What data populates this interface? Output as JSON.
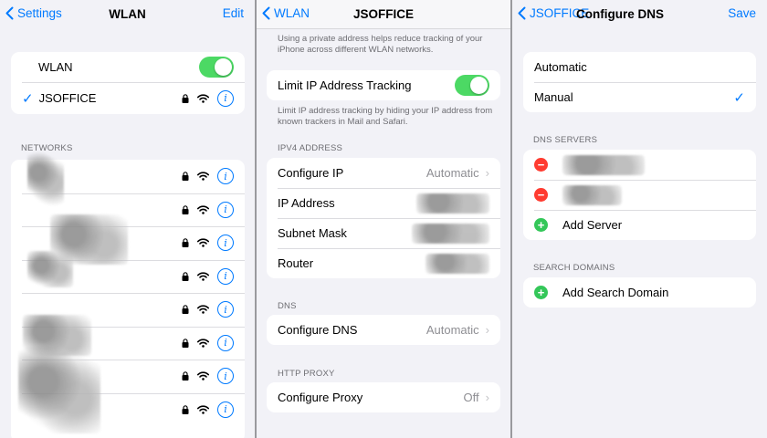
{
  "panel1": {
    "back_label": "Settings",
    "title": "WLAN",
    "right_action": "Edit",
    "wlan_toggle_label": "WLAN",
    "wlan_toggle_on": true,
    "connected_network": "JSOFFICE",
    "networks_header": "NETWORKS",
    "network_rows": 8
  },
  "panel2": {
    "back_label": "WLAN",
    "title": "JSOFFICE",
    "private_note": "Using a private address helps reduce tracking of your iPhone across different WLAN networks.",
    "limit_tracking_label": "Limit IP Address Tracking",
    "limit_tracking_on": true,
    "limit_tracking_note": "Limit IP address tracking by hiding your IP address from known trackers in Mail and Safari.",
    "ipv4_header": "IPV4 ADDRESS",
    "configure_ip_label": "Configure IP",
    "configure_ip_value": "Automatic",
    "ip_address_label": "IP Address",
    "subnet_mask_label": "Subnet Mask",
    "router_label": "Router",
    "dns_header": "DNS",
    "configure_dns_label": "Configure DNS",
    "configure_dns_value": "Automatic",
    "http_proxy_header": "HTTP PROXY",
    "configure_proxy_label": "Configure Proxy",
    "configure_proxy_value": "Off"
  },
  "panel3": {
    "back_label": "JSOFFICE",
    "title": "Configure DNS",
    "right_action": "Save",
    "mode_automatic": "Automatic",
    "mode_manual": "Manual",
    "selected_mode": "Manual",
    "dns_servers_header": "DNS SERVERS",
    "add_server_label": "Add Server",
    "search_domains_header": "SEARCH DOMAINS",
    "add_search_domain_label": "Add Search Domain"
  },
  "colors": {
    "accent": "#007aff",
    "toggle_on": "#4cd964",
    "add": "#34c759",
    "remove": "#ff3b30"
  }
}
